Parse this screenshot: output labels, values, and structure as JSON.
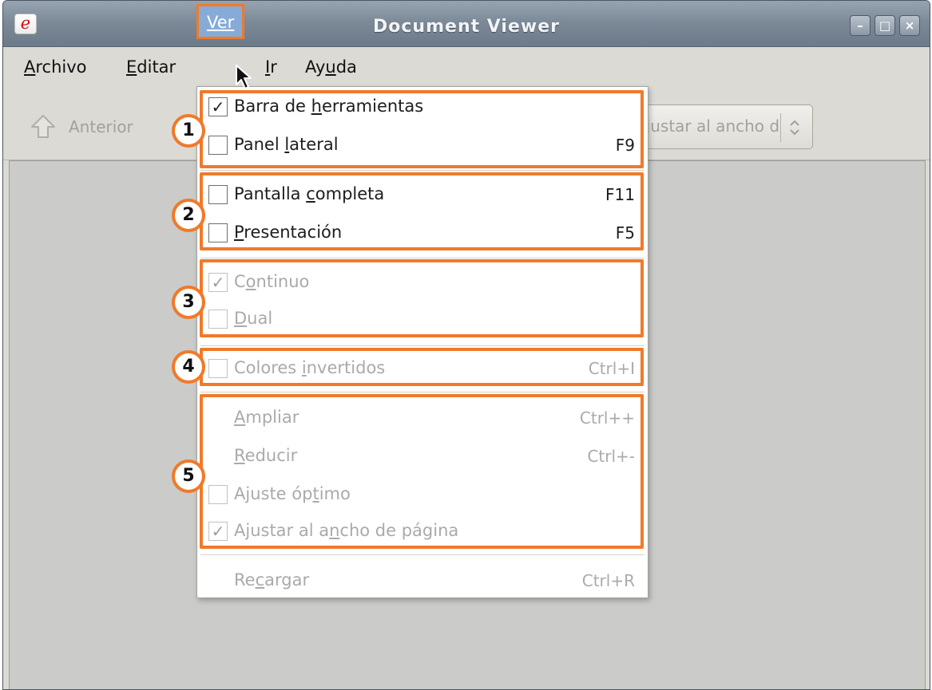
{
  "window": {
    "title": "Document Viewer",
    "app_icon": "e",
    "minimize_glyph": "–",
    "maximize_glyph": "□",
    "close_glyph": "×"
  },
  "menubar": {
    "archivo": {
      "pre": "",
      "u": "A",
      "post": "rchivo"
    },
    "editar": {
      "pre": "",
      "u": "E",
      "post": "ditar"
    },
    "ver": {
      "pre": "",
      "u": "Ver",
      "post": ""
    },
    "ir": {
      "pre": "",
      "u": "I",
      "post": "r"
    },
    "ayuda": {
      "pre": "Ay",
      "u": "u",
      "post": "da"
    }
  },
  "toolbar": {
    "anterior_label": "Anterior",
    "zoom_combo_text": "Ajustar al ancho de página"
  },
  "dropdown": {
    "barra": {
      "checked": "✓",
      "pre": "Barra de ",
      "u": "h",
      "post": "erramientas",
      "shortcut": ""
    },
    "panel": {
      "checked": "",
      "pre": "Panel ",
      "u": "l",
      "post": "ateral",
      "shortcut": "F9"
    },
    "pantalla": {
      "checked": "",
      "pre": "Pantalla ",
      "u": "c",
      "post": "ompleta",
      "shortcut": "F11"
    },
    "presentacion": {
      "checked": "",
      "pre": "",
      "u": "P",
      "post": "resentación",
      "shortcut": "F5"
    },
    "continuo": {
      "checked": "✓",
      "pre": "C",
      "u": "o",
      "post": "ntinuo",
      "shortcut": ""
    },
    "dual": {
      "checked": "",
      "pre": "",
      "u": "D",
      "post": "ual",
      "shortcut": ""
    },
    "colores": {
      "checked": "",
      "pre": "Colores ",
      "u": "i",
      "post": "nvertidos",
      "shortcut": "Ctrl+I"
    },
    "ampliar": {
      "pre": "",
      "u": "A",
      "post": "mpliar",
      "shortcut": "Ctrl++"
    },
    "reducir": {
      "pre": "",
      "u": "R",
      "post": "educir",
      "shortcut": "Ctrl+-"
    },
    "ajuste": {
      "checked": "",
      "pre": "Ajuste óp",
      "u": "t",
      "post": "imo",
      "shortcut": ""
    },
    "ajustar": {
      "checked": "✓",
      "pre": "Ajustar al a",
      "u": "n",
      "post": "cho de página",
      "shortcut": ""
    },
    "recargar": {
      "pre": "Re",
      "u": "c",
      "post": "argar",
      "shortcut": "Ctrl+R"
    }
  },
  "annotations": {
    "badge_1": "1",
    "badge_2": "2",
    "badge_3": "3",
    "badge_4": "4",
    "badge_5": "5",
    "highlight_color": "#f07a29"
  },
  "colors": {
    "menu_highlight": "#86abd9",
    "disabled_text": "#aaaaaa",
    "titlebar": "#7d8a98"
  }
}
